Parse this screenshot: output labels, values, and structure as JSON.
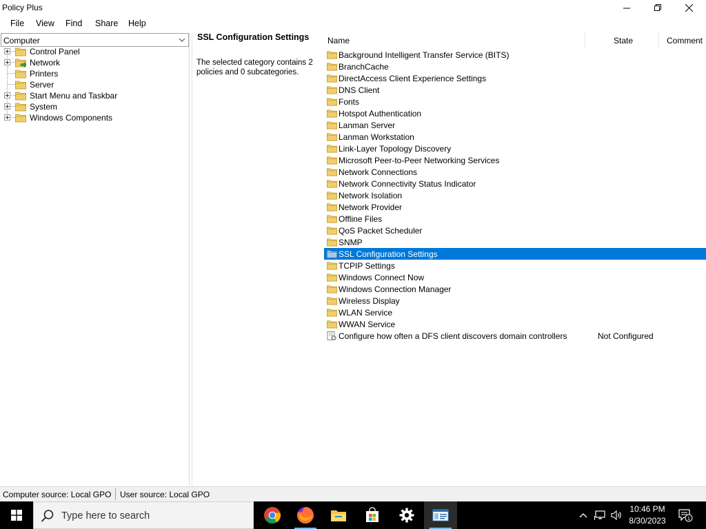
{
  "window": {
    "title": "Policy Plus"
  },
  "menu": [
    "File",
    "View",
    "Find",
    "Share",
    "Help"
  ],
  "left": {
    "source_select": "Computer",
    "tree": [
      {
        "label": "Control Panel",
        "expandable": true,
        "icon": "folder"
      },
      {
        "label": "Network",
        "expandable": true,
        "icon": "folder-open-arrow"
      },
      {
        "label": "Printers",
        "expandable": false,
        "icon": "folder"
      },
      {
        "label": "Server",
        "expandable": false,
        "icon": "folder"
      },
      {
        "label": "Start Menu and Taskbar",
        "expandable": true,
        "icon": "folder"
      },
      {
        "label": "System",
        "expandable": true,
        "icon": "folder"
      },
      {
        "label": "Windows Components",
        "expandable": true,
        "icon": "folder"
      }
    ]
  },
  "middle": {
    "category_title": "SSL Configuration Settings",
    "description": "The selected category contains 2 policies and 0 subcategories."
  },
  "list": {
    "columns": {
      "name": "Name",
      "state": "State",
      "comment": "Comment"
    },
    "rows": [
      {
        "name": "Background Intelligent Transfer Service (BITS)",
        "type": "folder",
        "state": ""
      },
      {
        "name": "BranchCache",
        "type": "folder",
        "state": ""
      },
      {
        "name": "DirectAccess Client Experience Settings",
        "type": "folder",
        "state": ""
      },
      {
        "name": "DNS Client",
        "type": "folder",
        "state": ""
      },
      {
        "name": "Fonts",
        "type": "folder",
        "state": ""
      },
      {
        "name": "Hotspot Authentication",
        "type": "folder",
        "state": ""
      },
      {
        "name": "Lanman Server",
        "type": "folder",
        "state": ""
      },
      {
        "name": "Lanman Workstation",
        "type": "folder",
        "state": ""
      },
      {
        "name": "Link-Layer Topology Discovery",
        "type": "folder",
        "state": ""
      },
      {
        "name": "Microsoft Peer-to-Peer Networking Services",
        "type": "folder",
        "state": ""
      },
      {
        "name": "Network Connections",
        "type": "folder",
        "state": ""
      },
      {
        "name": "Network Connectivity Status Indicator",
        "type": "folder",
        "state": ""
      },
      {
        "name": "Network Isolation",
        "type": "folder",
        "state": ""
      },
      {
        "name": "Network Provider",
        "type": "folder",
        "state": ""
      },
      {
        "name": "Offline Files",
        "type": "folder",
        "state": ""
      },
      {
        "name": "QoS Packet Scheduler",
        "type": "folder",
        "state": ""
      },
      {
        "name": "SNMP",
        "type": "folder",
        "state": ""
      },
      {
        "name": "SSL Configuration Settings",
        "type": "folder",
        "state": "",
        "selected": true
      },
      {
        "name": "TCPIP Settings",
        "type": "folder",
        "state": ""
      },
      {
        "name": "Windows Connect Now",
        "type": "folder",
        "state": ""
      },
      {
        "name": "Windows Connection Manager",
        "type": "folder",
        "state": ""
      },
      {
        "name": "Wireless Display",
        "type": "folder",
        "state": ""
      },
      {
        "name": "WLAN Service",
        "type": "folder",
        "state": ""
      },
      {
        "name": "WWAN Service",
        "type": "folder",
        "state": ""
      },
      {
        "name": "Configure how often a DFS client discovers domain controllers",
        "type": "policy",
        "state": "Not Configured"
      }
    ]
  },
  "status": {
    "computer_source": "Computer source:  Local GPO",
    "user_source": "User source:  Local GPO"
  },
  "taskbar": {
    "search_placeholder": "Type here to search",
    "apps": [
      "chrome-icon",
      "firefox-icon",
      "file-explorer-icon",
      "store-icon",
      "settings-icon",
      "policy-plus-icon"
    ],
    "time": "10:46 PM",
    "date": "8/30/2023",
    "notification_count": "1"
  },
  "colors": {
    "selection": "#0078d7",
    "folder": "#e8c25a",
    "taskbar": "#000000"
  }
}
